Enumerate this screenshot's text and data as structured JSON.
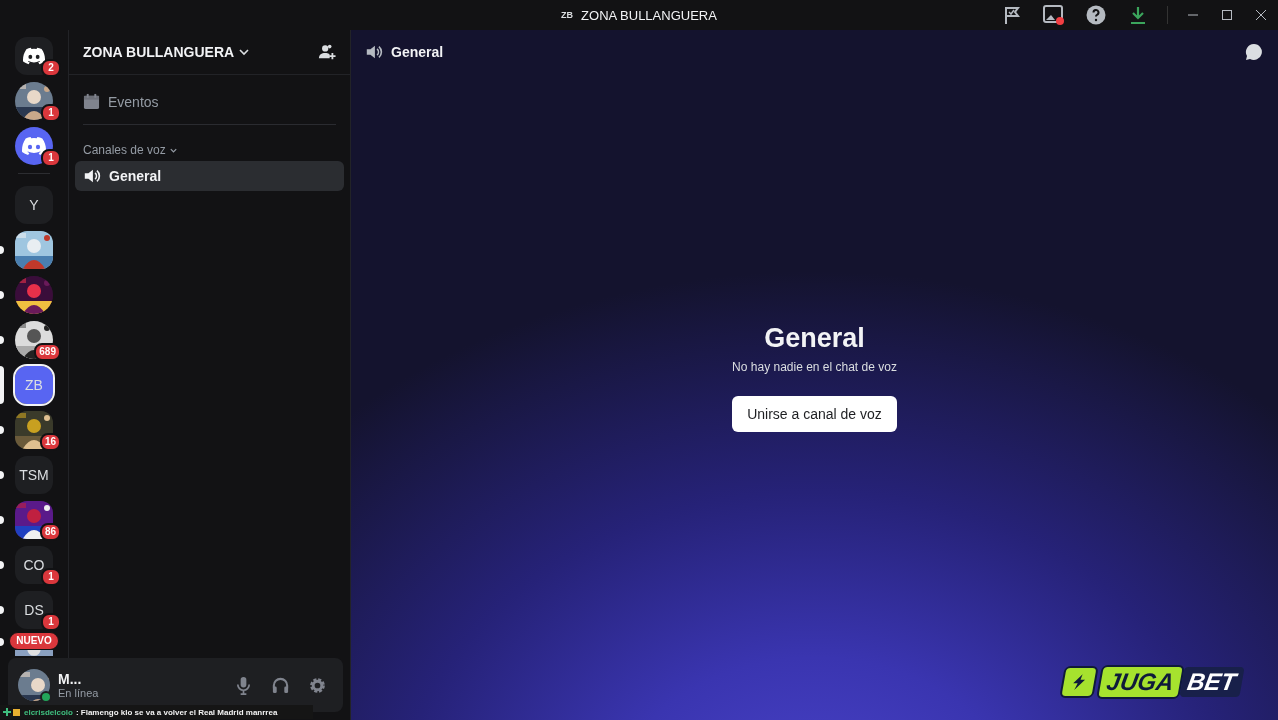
{
  "window": {
    "server_badge": "ZB",
    "title": "ZONA BULLANGUERA"
  },
  "servers": [
    {
      "kind": "logo",
      "badge": "2",
      "unread": false,
      "selected": false
    },
    {
      "kind": "picture",
      "badge": "1",
      "unread": false,
      "selected": false
    },
    {
      "kind": "logo-brand",
      "badge": "1",
      "unread": false,
      "selected": false
    },
    {
      "kind": "separator"
    },
    {
      "kind": "initials",
      "label": "Y",
      "unread": false,
      "selected": false
    },
    {
      "kind": "picture",
      "unread": true,
      "selected": false
    },
    {
      "kind": "picture",
      "unread": true,
      "selected": false
    },
    {
      "kind": "picture",
      "badge": "689",
      "unread": true,
      "selected": false
    },
    {
      "kind": "initials",
      "label": "ZB",
      "unread": false,
      "selected": true
    },
    {
      "kind": "picture",
      "badge": "16",
      "unread": true,
      "selected": false
    },
    {
      "kind": "initials",
      "label": "TSM",
      "unread": true,
      "selected": false
    },
    {
      "kind": "picture",
      "badge": "86",
      "unread": true,
      "selected": false
    },
    {
      "kind": "initials",
      "label": "CO",
      "badge": "1",
      "unread": true,
      "selected": false
    },
    {
      "kind": "initials",
      "label": "DS",
      "badge": "1",
      "unread": true,
      "selected": false
    },
    {
      "kind": "picture",
      "new_label": "NUEVO",
      "unread": true,
      "selected": false
    }
  ],
  "channel_sidebar": {
    "server_name": "ZONA BULLANGUERA",
    "items": [
      {
        "label": "Eventos"
      }
    ],
    "categories": [
      {
        "label": "Canales de voz",
        "expanded": true,
        "channels": [
          {
            "name": "General",
            "selected": true
          }
        ]
      }
    ]
  },
  "user_panel": {
    "name": "M...",
    "status": "En línea"
  },
  "channel_header": {
    "name": "General"
  },
  "voice_empty": {
    "title": "General",
    "message": "No hay nadie en el chat de voz",
    "button": "Unirse a canal de voz"
  },
  "overlay": {
    "chat_user": "elcrisdelcolo",
    "chat_message": ": Flamengo klo se va a volver el Real Madrid manrrea",
    "sponsor": [
      "JUGA",
      "BET"
    ]
  }
}
